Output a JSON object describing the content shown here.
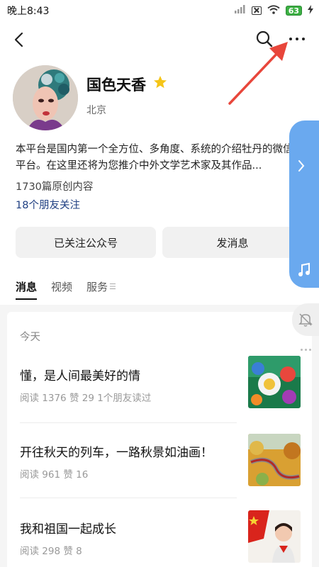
{
  "status_bar": {
    "time": "晚上8:43",
    "battery": "63"
  },
  "profile": {
    "name": "国色天香",
    "location": "北京",
    "description": "本平台是国内第一个全方位、多角度、系统的介绍牡丹的微信平台。在这里还将为您推介中外文学艺术家及其作品...",
    "article_count": "1730篇原创内容",
    "friends_follow": "18个朋友关注"
  },
  "actions": {
    "follow_label": "已关注公众号",
    "message_label": "发消息"
  },
  "tabs": [
    {
      "label": "消息"
    },
    {
      "label": "视频"
    },
    {
      "label": "服务"
    }
  ],
  "feed": {
    "day_label": "今天",
    "articles": [
      {
        "title": "懂，是人间最美好的情",
        "meta": "阅读 1376   赞 29   1个朋友读过"
      },
      {
        "title": "开往秋天的列车，一路秋景如油画！",
        "meta": "阅读 961   赞 16"
      },
      {
        "title": "我和祖国一起成长",
        "meta": "阅读 298   赞 8"
      }
    ]
  },
  "colors": {
    "accent_link": "#1f3f82",
    "side_panel": "#6aa9ef",
    "arrow": "#e8463b",
    "star": "#f5c518"
  }
}
